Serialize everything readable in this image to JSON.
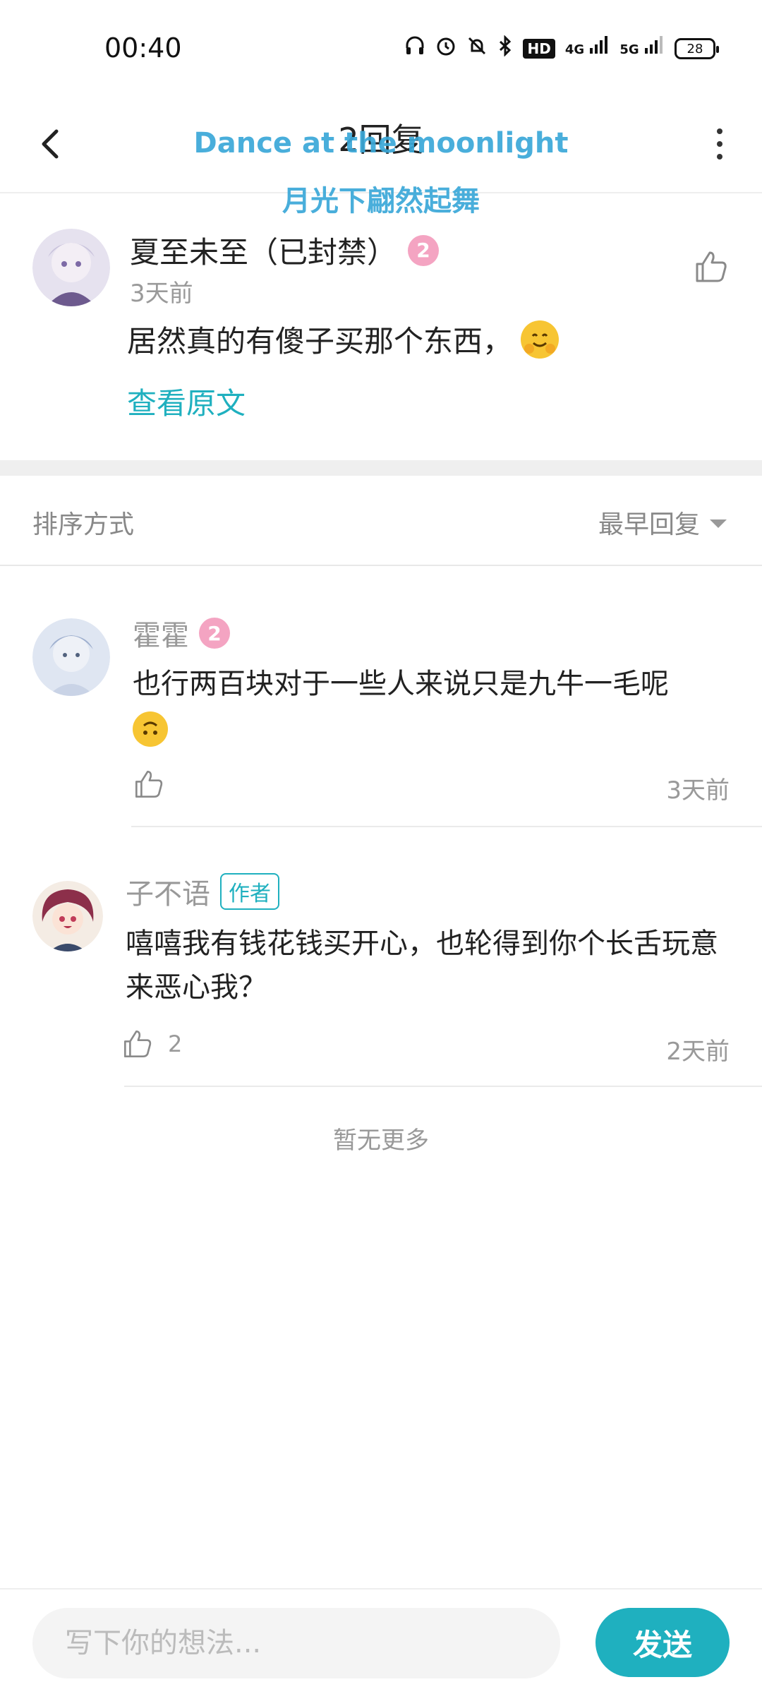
{
  "status_bar": {
    "time": "00:40",
    "icons": [
      "headphones-icon",
      "alarm-icon",
      "mute-icon",
      "bluetooth-icon",
      "hd-icon",
      "4g-signal-icon",
      "5g-signal-icon",
      "battery-icon"
    ],
    "hd_label": "HD",
    "net1_label": "4G",
    "net2_label": "5G",
    "battery": "28"
  },
  "header": {
    "title": "2回复",
    "watermark_line1": "Dance at the moonlight",
    "watermark_line2": "月光下翩然起舞"
  },
  "original_comment": {
    "author": "夏至未至（已封禁）",
    "level": "2",
    "time": "3天前",
    "text": "居然真的有傻子买那个东西，",
    "emoji": "hugging-face-emoji",
    "view_original": "查看原文"
  },
  "sort": {
    "label": "排序方式",
    "selected": "最早回复"
  },
  "replies": [
    {
      "author": "霍霍",
      "level": "2",
      "text": "也行两百块对于一些人来说只是九牛一毛呢",
      "emoji": "upside-down-face-emoji",
      "likes": "",
      "time": "3天前"
    },
    {
      "author": "子不语",
      "badge": "作者",
      "text": "嘻嘻我有钱花钱买开心，也轮得到你个长舌玩意来恶心我？",
      "likes": "2",
      "time": "2天前"
    }
  ],
  "footer_note": "暂无更多",
  "composer": {
    "placeholder": "写下你的想法...",
    "send_label": "发送"
  },
  "colors": {
    "accent": "#1fb0bf",
    "level_badge": "#f4a4c2",
    "watermark": "#3aa8d8"
  }
}
